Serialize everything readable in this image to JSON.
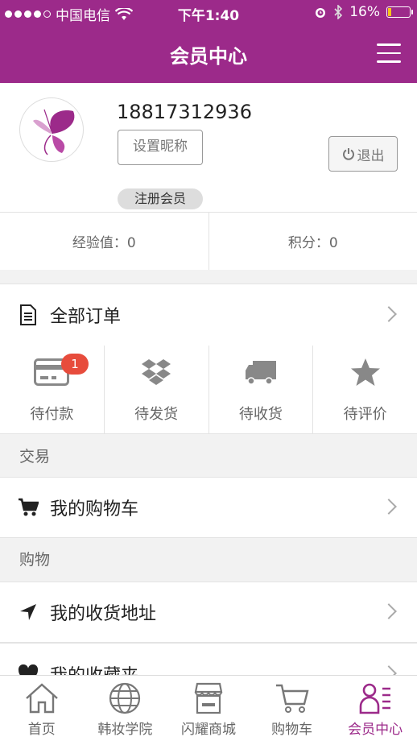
{
  "status_bar": {
    "carrier": "中国电信",
    "time": "下午1:40",
    "battery": "16%",
    "battery_level": 0.16
  },
  "header": {
    "title": "会员中心"
  },
  "profile": {
    "phone": "18817312936",
    "set_nickname": "设置昵称",
    "logout": "退出",
    "member_level": "注册会员"
  },
  "stats": {
    "experience": "经验值：0",
    "points": "积分：0"
  },
  "orders": {
    "all_orders": "全部订单",
    "items": [
      {
        "label": "待付款",
        "icon": "credit-card-icon",
        "badge": "1"
      },
      {
        "label": "待发货",
        "icon": "dropbox-icon"
      },
      {
        "label": "待收货",
        "icon": "truck-icon"
      },
      {
        "label": "待评价",
        "icon": "star-icon"
      }
    ]
  },
  "sections": {
    "trade": {
      "title": "交易",
      "items": [
        {
          "label": "我的购物车",
          "icon": "cart-icon"
        }
      ]
    },
    "shopping": {
      "title": "购物",
      "items": [
        {
          "label": "我的收货地址",
          "icon": "location-arrow-icon"
        },
        {
          "label": "我的收藏夹",
          "icon": "heart-icon"
        }
      ]
    }
  },
  "tabbar": {
    "items": [
      {
        "label": "首页",
        "icon": "home-icon"
      },
      {
        "label": "韩妆学院",
        "icon": "globe-icon"
      },
      {
        "label": "闪耀商城",
        "icon": "store-icon"
      },
      {
        "label": "购物车",
        "icon": "cart-icon"
      },
      {
        "label": "会员中心",
        "icon": "member-icon",
        "active": true
      }
    ]
  },
  "colors": {
    "brand": "#9c2a8a",
    "badge": "#e74c3c"
  }
}
